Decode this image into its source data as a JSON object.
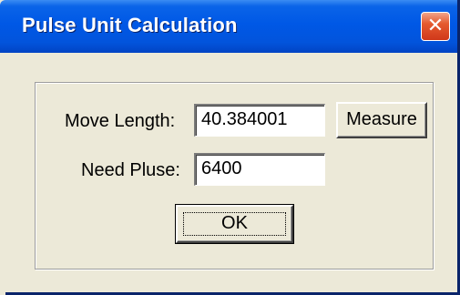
{
  "window": {
    "title": "Pulse Unit Calculation",
    "close_icon": "close-icon",
    "close_glyph": "✕",
    "titlebar_color": "#0058e6",
    "close_color": "#e55a2f",
    "body_color": "#ece9d8"
  },
  "form": {
    "move_length_label": "Move Length:",
    "move_length_value": "40.384001",
    "measure_label": "Measure",
    "need_pulse_label": "Need Pluse:",
    "need_pulse_value": "6400",
    "ok_label": "OK"
  }
}
